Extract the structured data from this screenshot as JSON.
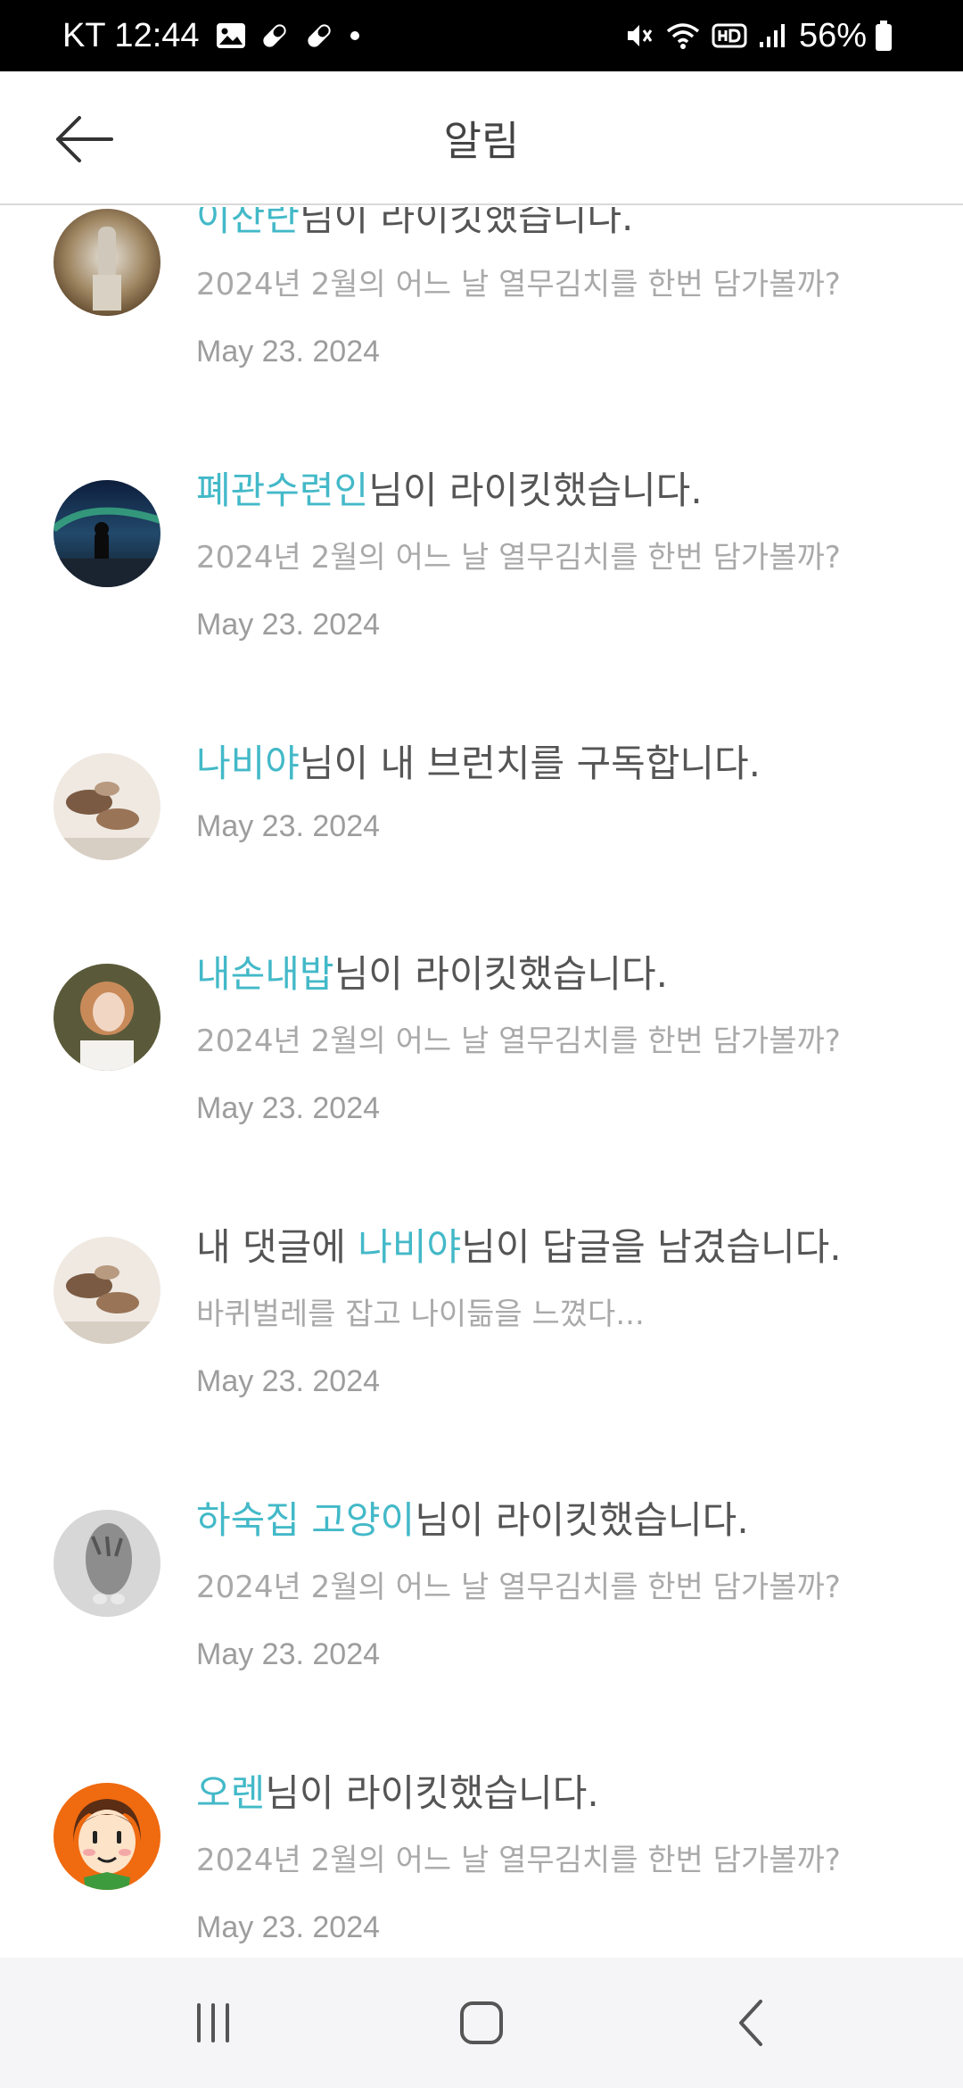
{
  "status_bar": {
    "carrier_time": "KT 12:44",
    "battery": "56%",
    "icons": [
      "image-icon",
      "pill-icon",
      "pill-icon",
      "dot-icon",
      "mute-icon",
      "wifi-icon",
      "hd-icon",
      "signal-icon",
      "battery-icon"
    ]
  },
  "header": {
    "title": "알림",
    "back_icon": "arrow-left-icon"
  },
  "notifications": [
    {
      "prefix": "",
      "nick": "이찬란",
      "suffix": "님이 라이킷했습니다.",
      "subtext": "2024년 2월의 어느 날 열무김치를 한번 담가볼까?",
      "date": "May 23. 2024",
      "avatar": "avatar-woman-standing"
    },
    {
      "prefix": "",
      "nick": "폐관수련인",
      "suffix": "님이 라이킷했습니다.",
      "subtext": "2024년 2월의 어느 날 열무김치를 한번 담가볼까?",
      "date": "May 23. 2024",
      "avatar": "avatar-aurora-night"
    },
    {
      "prefix": "",
      "nick": "나비야",
      "suffix": "님이 내 브런치를 구독합니다.",
      "subtext": "",
      "date": "May 23. 2024",
      "avatar": "avatar-pebbles"
    },
    {
      "prefix": "",
      "nick": "내손내밥",
      "suffix": "님이 라이킷했습니다.",
      "subtext": "2024년 2월의 어느 날 열무김치를 한번 담가볼까?",
      "date": "May 23. 2024",
      "avatar": "avatar-woman-portrait"
    },
    {
      "prefix": "내 댓글에 ",
      "nick": "나비야",
      "suffix": "님이 답글을 남겼습니다.",
      "subtext": "바퀴벌레를 잡고 나이듦을 느꼈다...",
      "date": "May 23. 2024",
      "avatar": "avatar-pebbles"
    },
    {
      "prefix": "",
      "nick": "하숙집 고양이",
      "suffix": "님이 라이킷했습니다.",
      "subtext": "2024년 2월의 어느 날 열무김치를 한번 담가볼까?",
      "date": "May 23. 2024",
      "avatar": "avatar-cat"
    },
    {
      "prefix": "",
      "nick": "오렌",
      "suffix": "님이 라이킷했습니다.",
      "subtext": "2024년 2월의 어느 날 열무김치를 한번 담가볼까?",
      "date": "May 23. 2024",
      "avatar": "avatar-cartoon-face"
    }
  ],
  "nav": {
    "recent": "recent-apps-icon",
    "home": "home-icon",
    "back": "back-chevron-icon"
  },
  "colors": {
    "accent": "#43b9c8",
    "status_bar": "#000000",
    "navbar": "#f5f5f7"
  }
}
